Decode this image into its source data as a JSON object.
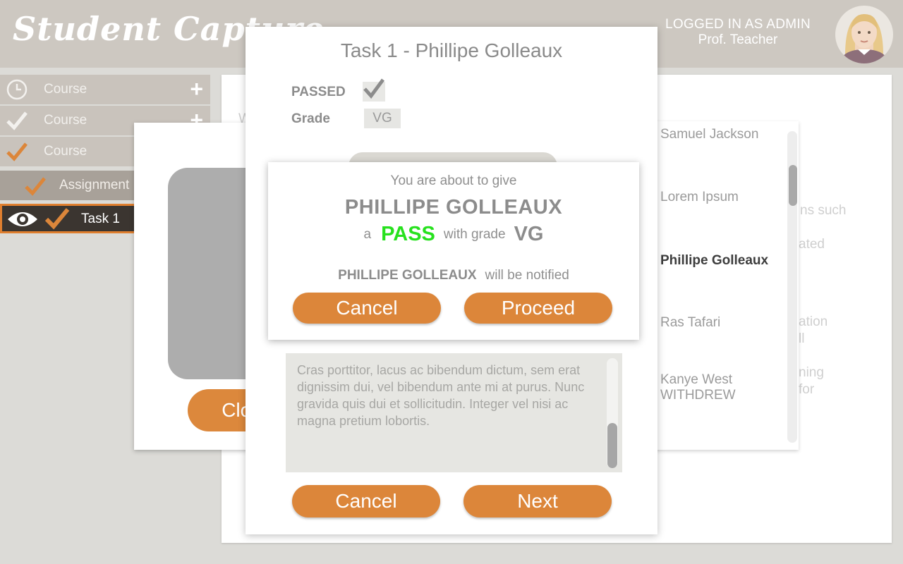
{
  "header": {
    "logo": "Student Capture",
    "login_label": "LOGGED IN AS ADMIN",
    "login_name": "Prof. Teacher"
  },
  "sidebar": {
    "items": [
      {
        "label": "Course",
        "icon": "clock-icon",
        "action": "+"
      },
      {
        "label": "Course",
        "icon": "check-icon",
        "action": "+"
      },
      {
        "label": "Course",
        "icon": "check-orange-icon"
      }
    ],
    "assignment": {
      "label": "Assignment",
      "icon": "check-orange-icon"
    },
    "task": {
      "label": "Task 1",
      "icon": "check-orange-icon",
      "view_icon": "eye-icon"
    }
  },
  "background": {
    "heading_fragment": "W",
    "fragments": [
      "ns such",
      "ated",
      "ation",
      "ll",
      "ning",
      "for"
    ]
  },
  "students": [
    {
      "name": "Samuel Jackson"
    },
    {
      "name": "Lorem Ipsum"
    },
    {
      "name": "Phillipe Golleaux",
      "selected": true
    },
    {
      "name": "Ras Tafari"
    },
    {
      "name": "Kanye West",
      "note": "WITHDREW"
    }
  ],
  "left_modal": {
    "close_label": "Close"
  },
  "task_modal": {
    "title": "Task 1 - Phillipe Golleaux",
    "passed_label": "PASSED",
    "passed_checked": true,
    "grade_label": "Grade",
    "grade_value": "VG",
    "comment": "Cras porttitor, lacus ac bibendum dictum, sem erat dignissim dui, vel bibendum ante mi at purus. Nunc gravida quis dui et sollicitudin. Integer vel nisi ac magna pretium lobortis.",
    "cancel_label": "Cancel",
    "next_label": "Next"
  },
  "confirm": {
    "intro": "You are about to give",
    "student_name": "PHILLIPE GOLLEAUX",
    "a_text": "a",
    "result": "PASS",
    "with_grade_text": "with grade",
    "grade": "VG",
    "notify_name": "PHILLIPE GOLLEAUX",
    "notify_text": "will be notified",
    "cancel_label": "Cancel",
    "proceed_label": "Proceed"
  },
  "colors": {
    "accent": "#dc863a",
    "pass": "#27e11e",
    "header_bg": "#cdc8c1",
    "active_bg": "#3b3530"
  }
}
